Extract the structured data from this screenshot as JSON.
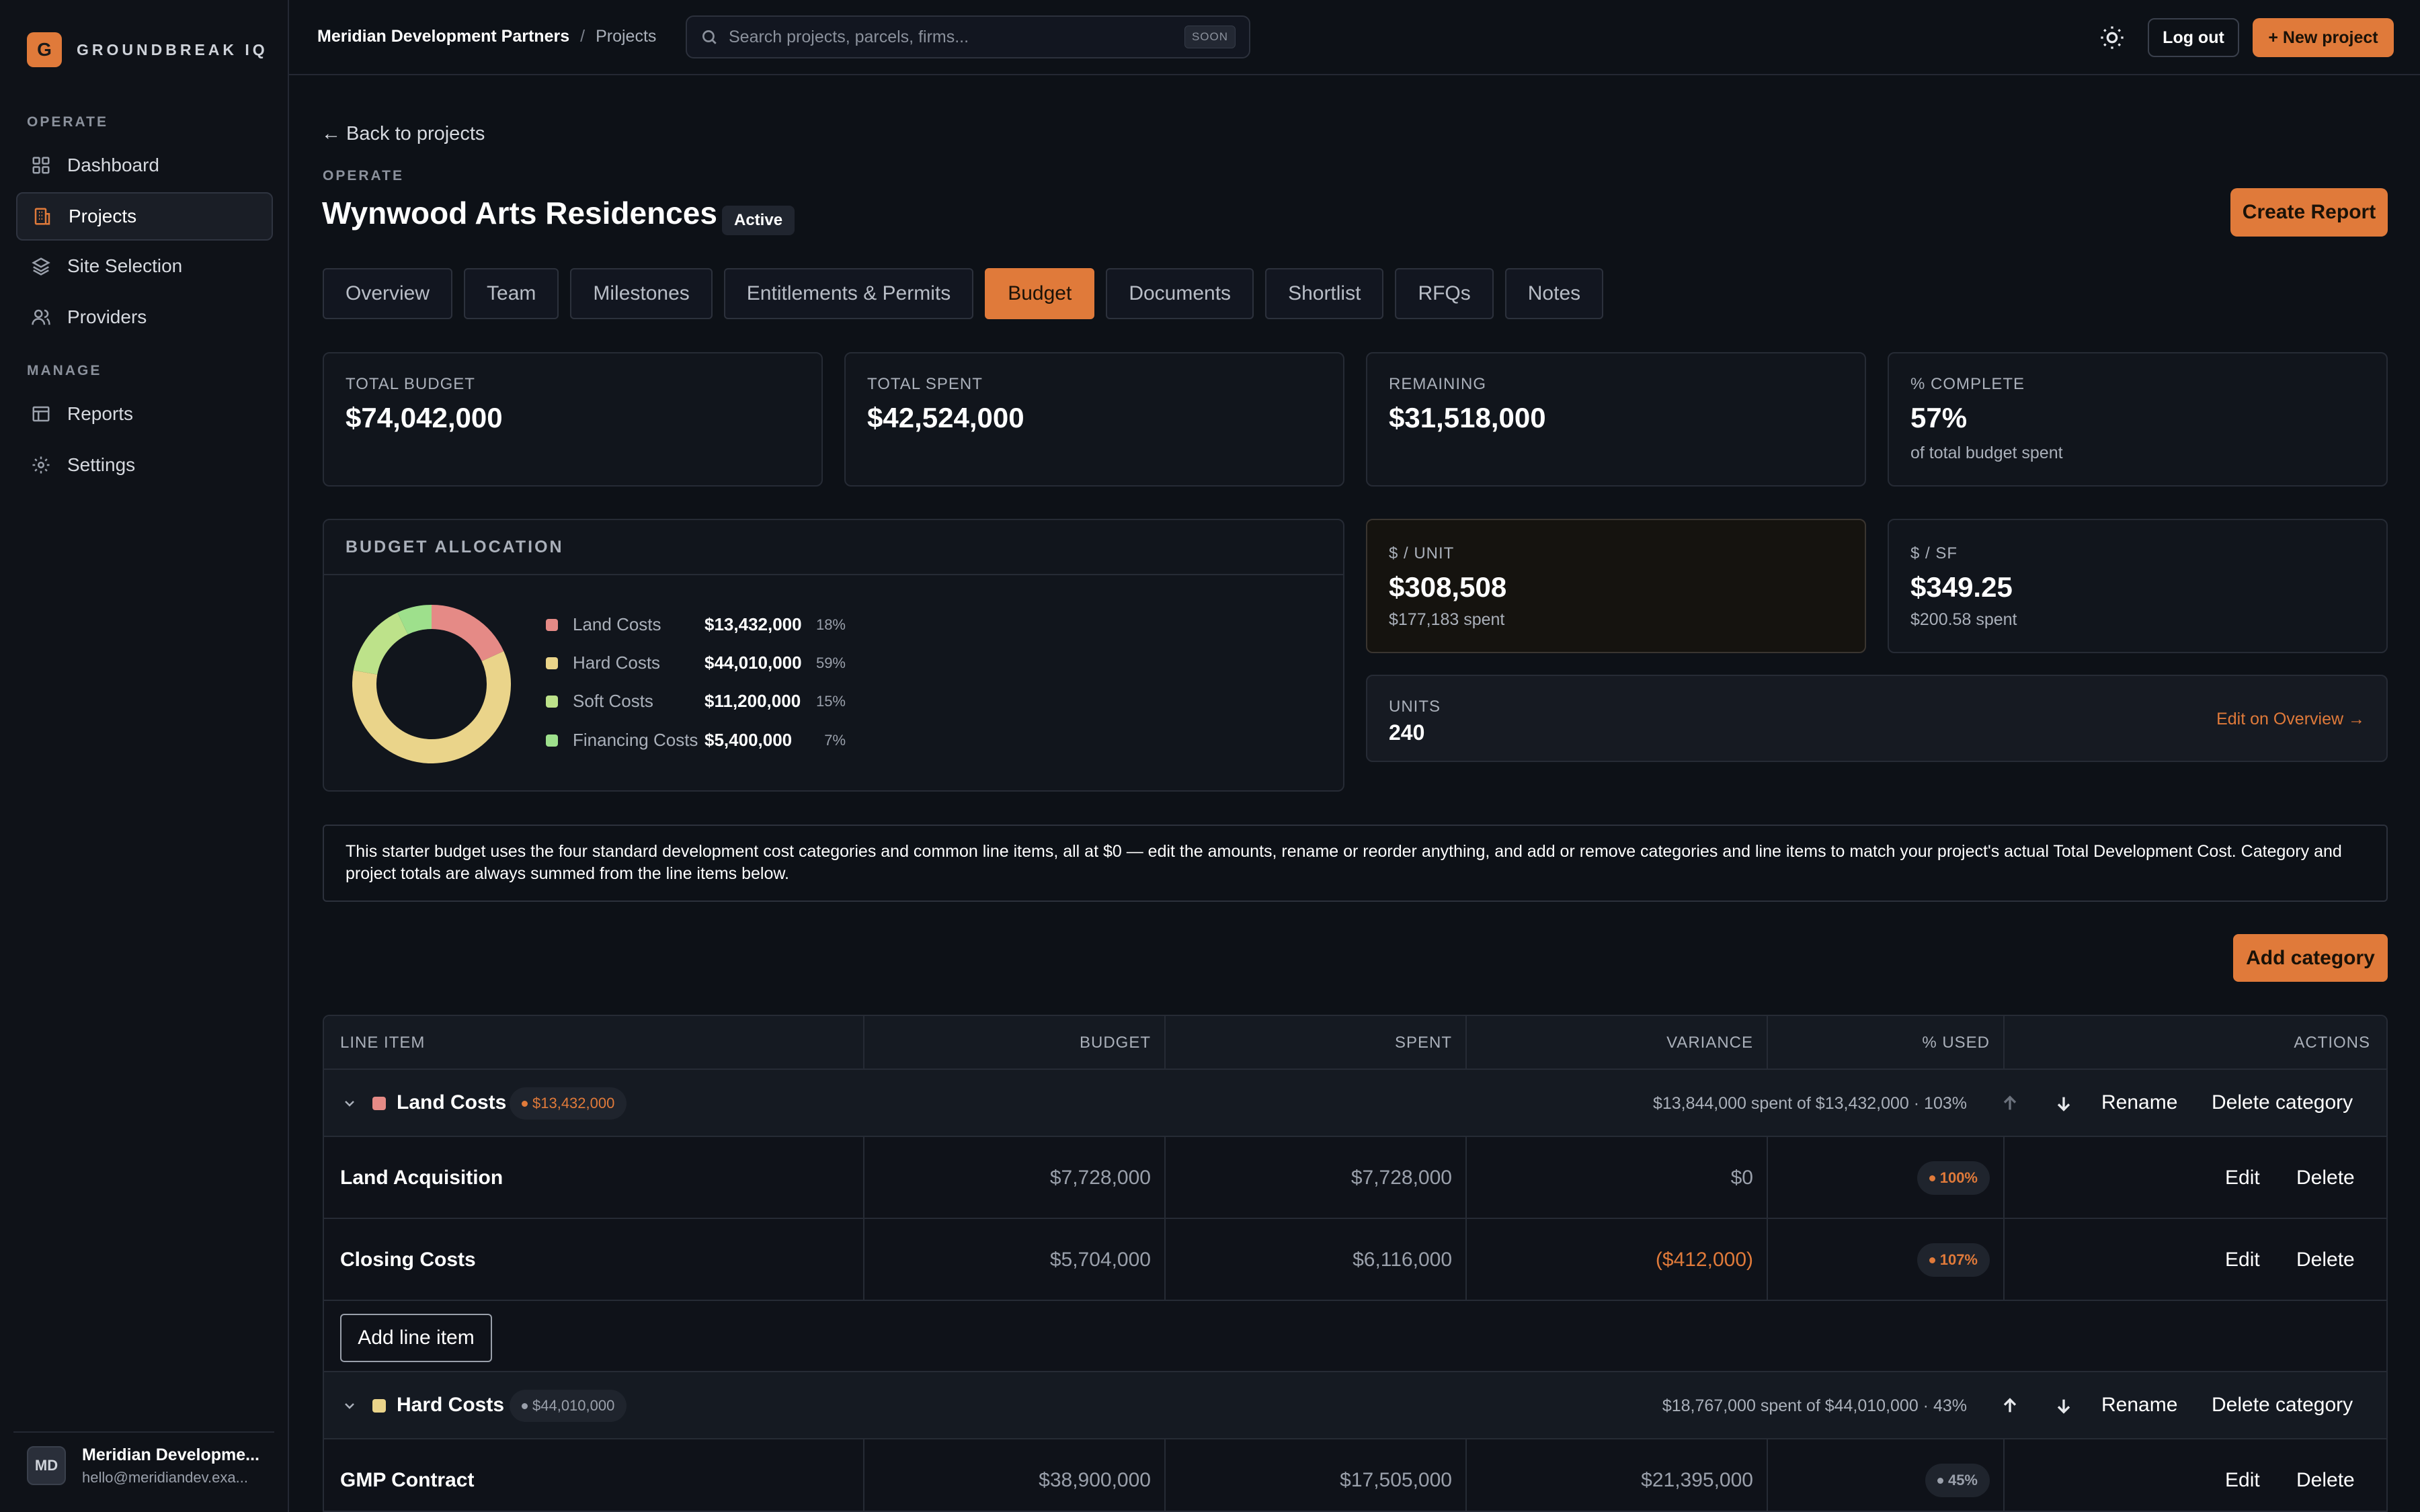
{
  "brand": {
    "logo_letter": "G",
    "name": "GROUNDBREAK IQ",
    "accent": "#e07a3a"
  },
  "sidebar": {
    "sections": [
      {
        "label": "OPERATE",
        "items": [
          {
            "label": "Dashboard",
            "icon": "grid-icon"
          },
          {
            "label": "Projects",
            "icon": "building-icon",
            "active": true
          },
          {
            "label": "Site Selection",
            "icon": "layers-icon"
          },
          {
            "label": "Providers",
            "icon": "users-icon"
          }
        ]
      },
      {
        "label": "MANAGE",
        "items": [
          {
            "label": "Reports",
            "icon": "table-icon"
          },
          {
            "label": "Settings",
            "icon": "gear-icon"
          }
        ]
      }
    ],
    "user": {
      "initials": "MD",
      "name": "Meridian Developme...",
      "email": "hello@meridiandev.exa..."
    }
  },
  "topbar": {
    "breadcrumb": {
      "org": "Meridian Development Partners",
      "separator": "/",
      "page": "Projects"
    },
    "search": {
      "placeholder": "Search projects, parcels, firms...",
      "badge": "SOON"
    },
    "logout_label": "Log out",
    "new_project_label": "+ New project"
  },
  "header": {
    "back_label": "← Back to projects",
    "eyebrow": "OPERATE",
    "title": "Wynwood Arts Residences",
    "status": "Active",
    "create_report_label": "Create Report"
  },
  "tabs": [
    "Overview",
    "Team",
    "Milestones",
    "Entitlements & Permits",
    "Budget",
    "Documents",
    "Shortlist",
    "RFQs",
    "Notes"
  ],
  "active_tab": "Budget",
  "stats": [
    {
      "label": "TOTAL BUDGET",
      "value": "$74,042,000"
    },
    {
      "label": "TOTAL SPENT",
      "value": "$42,524,000"
    },
    {
      "label": "REMAINING",
      "value": "$31,518,000"
    },
    {
      "label": "% COMPLETE",
      "value": "57%",
      "sub": "of total budget spent"
    }
  ],
  "allocation": {
    "title": "BUDGET ALLOCATION",
    "items": [
      {
        "name": "Land Costs",
        "value": "$13,432,000",
        "pct": "18%",
        "fraction": 0.18,
        "color": "#e58a86"
      },
      {
        "name": "Hard Costs",
        "value": "$44,010,000",
        "pct": "59%",
        "fraction": 0.59,
        "color": "#ead48a"
      },
      {
        "name": "Soft Costs",
        "value": "$11,200,000",
        "pct": "15%",
        "fraction": 0.15,
        "color": "#bde28a"
      },
      {
        "name": "Financing Costs",
        "value": "$5,400,000",
        "pct": "7%",
        "fraction": 0.07,
        "color": "#9ee08c"
      }
    ]
  },
  "per_unit": {
    "label": "$ / UNIT",
    "value": "$308,508",
    "sub": "$177,183 spent"
  },
  "per_sf": {
    "label": "$ / SF",
    "value": "$349.25",
    "sub": "$200.58 spent"
  },
  "units": {
    "label": "UNITS",
    "value": "240",
    "link": "Edit on Overview →"
  },
  "note": "This starter budget uses the four standard development cost categories and common line items, all at $0 — edit the amounts, rename or reorder anything, and add or remove categories and line items to match your project's actual Total Development Cost. Category and project totals are always summed from the line items below.",
  "add_category_label": "Add category",
  "table": {
    "columns": [
      "LINE ITEM",
      "BUDGET",
      "SPENT",
      "VARIANCE",
      "% USED",
      "ACTIONS"
    ],
    "rename_label": "Rename",
    "delete_category_label": "Delete category",
    "edit_label": "Edit",
    "delete_label": "Delete",
    "add_line_label": "Add line item",
    "categories": [
      {
        "name": "Land Costs",
        "color": "#e58a86",
        "budget": "$13,432,000",
        "pill_color": "#e07a3a",
        "summary": "$13,844,000 spent of $13,432,000 · 103%",
        "items": [
          {
            "name": "Land Acquisition",
            "budget": "$7,728,000",
            "spent": "$7,728,000",
            "variance": "$0",
            "used": "100%",
            "negative": false
          },
          {
            "name": "Closing Costs",
            "budget": "$5,704,000",
            "spent": "$6,116,000",
            "variance": "($412,000)",
            "used": "107%",
            "negative": true
          }
        ]
      },
      {
        "name": "Hard Costs",
        "color": "#ead48a",
        "budget": "$44,010,000",
        "pill_color": "#9aa0ab",
        "summary": "$18,767,000 spent of $44,010,000 · 43%",
        "items": [
          {
            "name": "GMP Contract",
            "budget": "$38,900,000",
            "spent": "$17,505,000",
            "variance": "$21,395,000",
            "used": "45%",
            "negative": false
          }
        ]
      }
    ]
  }
}
